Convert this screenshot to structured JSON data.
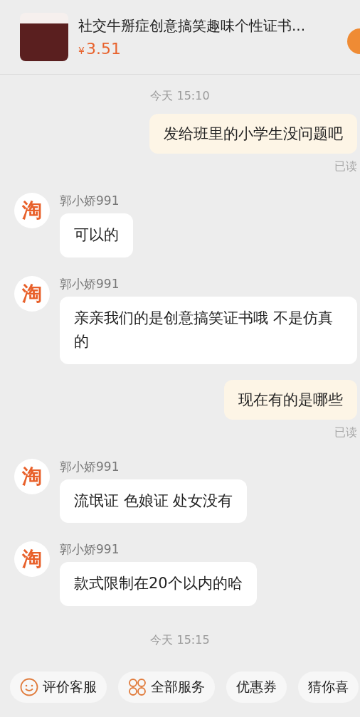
{
  "product": {
    "title": "社交牛掰症创意搞笑趣味个性证书...",
    "currency": "¥",
    "price": "3.51"
  },
  "messages": [
    {
      "kind": "time",
      "text": "今天 15:10"
    },
    {
      "kind": "sent",
      "text": "发给班里的小学生没问题吧",
      "status": "已读"
    },
    {
      "kind": "received",
      "sender": "郭小娇991",
      "avatar": "淘",
      "text": "可以的"
    },
    {
      "kind": "received",
      "sender": "郭小娇991",
      "avatar": "淘",
      "text": "亲亲我们的是创意搞笑证书哦 不是仿真的"
    },
    {
      "kind": "sent",
      "text": "现在有的是哪些",
      "status": "已读"
    },
    {
      "kind": "received",
      "sender": "郭小娇991",
      "avatar": "淘",
      "text": "流氓证 色娘证 处女没有"
    },
    {
      "kind": "received",
      "sender": "郭小娇991",
      "avatar": "淘",
      "text": "款式限制在20个以内的哈"
    },
    {
      "kind": "time",
      "text": "今天 15:15"
    }
  ],
  "quick_actions": [
    {
      "kind": "smile",
      "label": "评价客服"
    },
    {
      "kind": "grid",
      "label": "全部服务"
    },
    {
      "kind": "plain",
      "label": "优惠券"
    },
    {
      "kind": "plain",
      "label": "猜你喜"
    }
  ]
}
